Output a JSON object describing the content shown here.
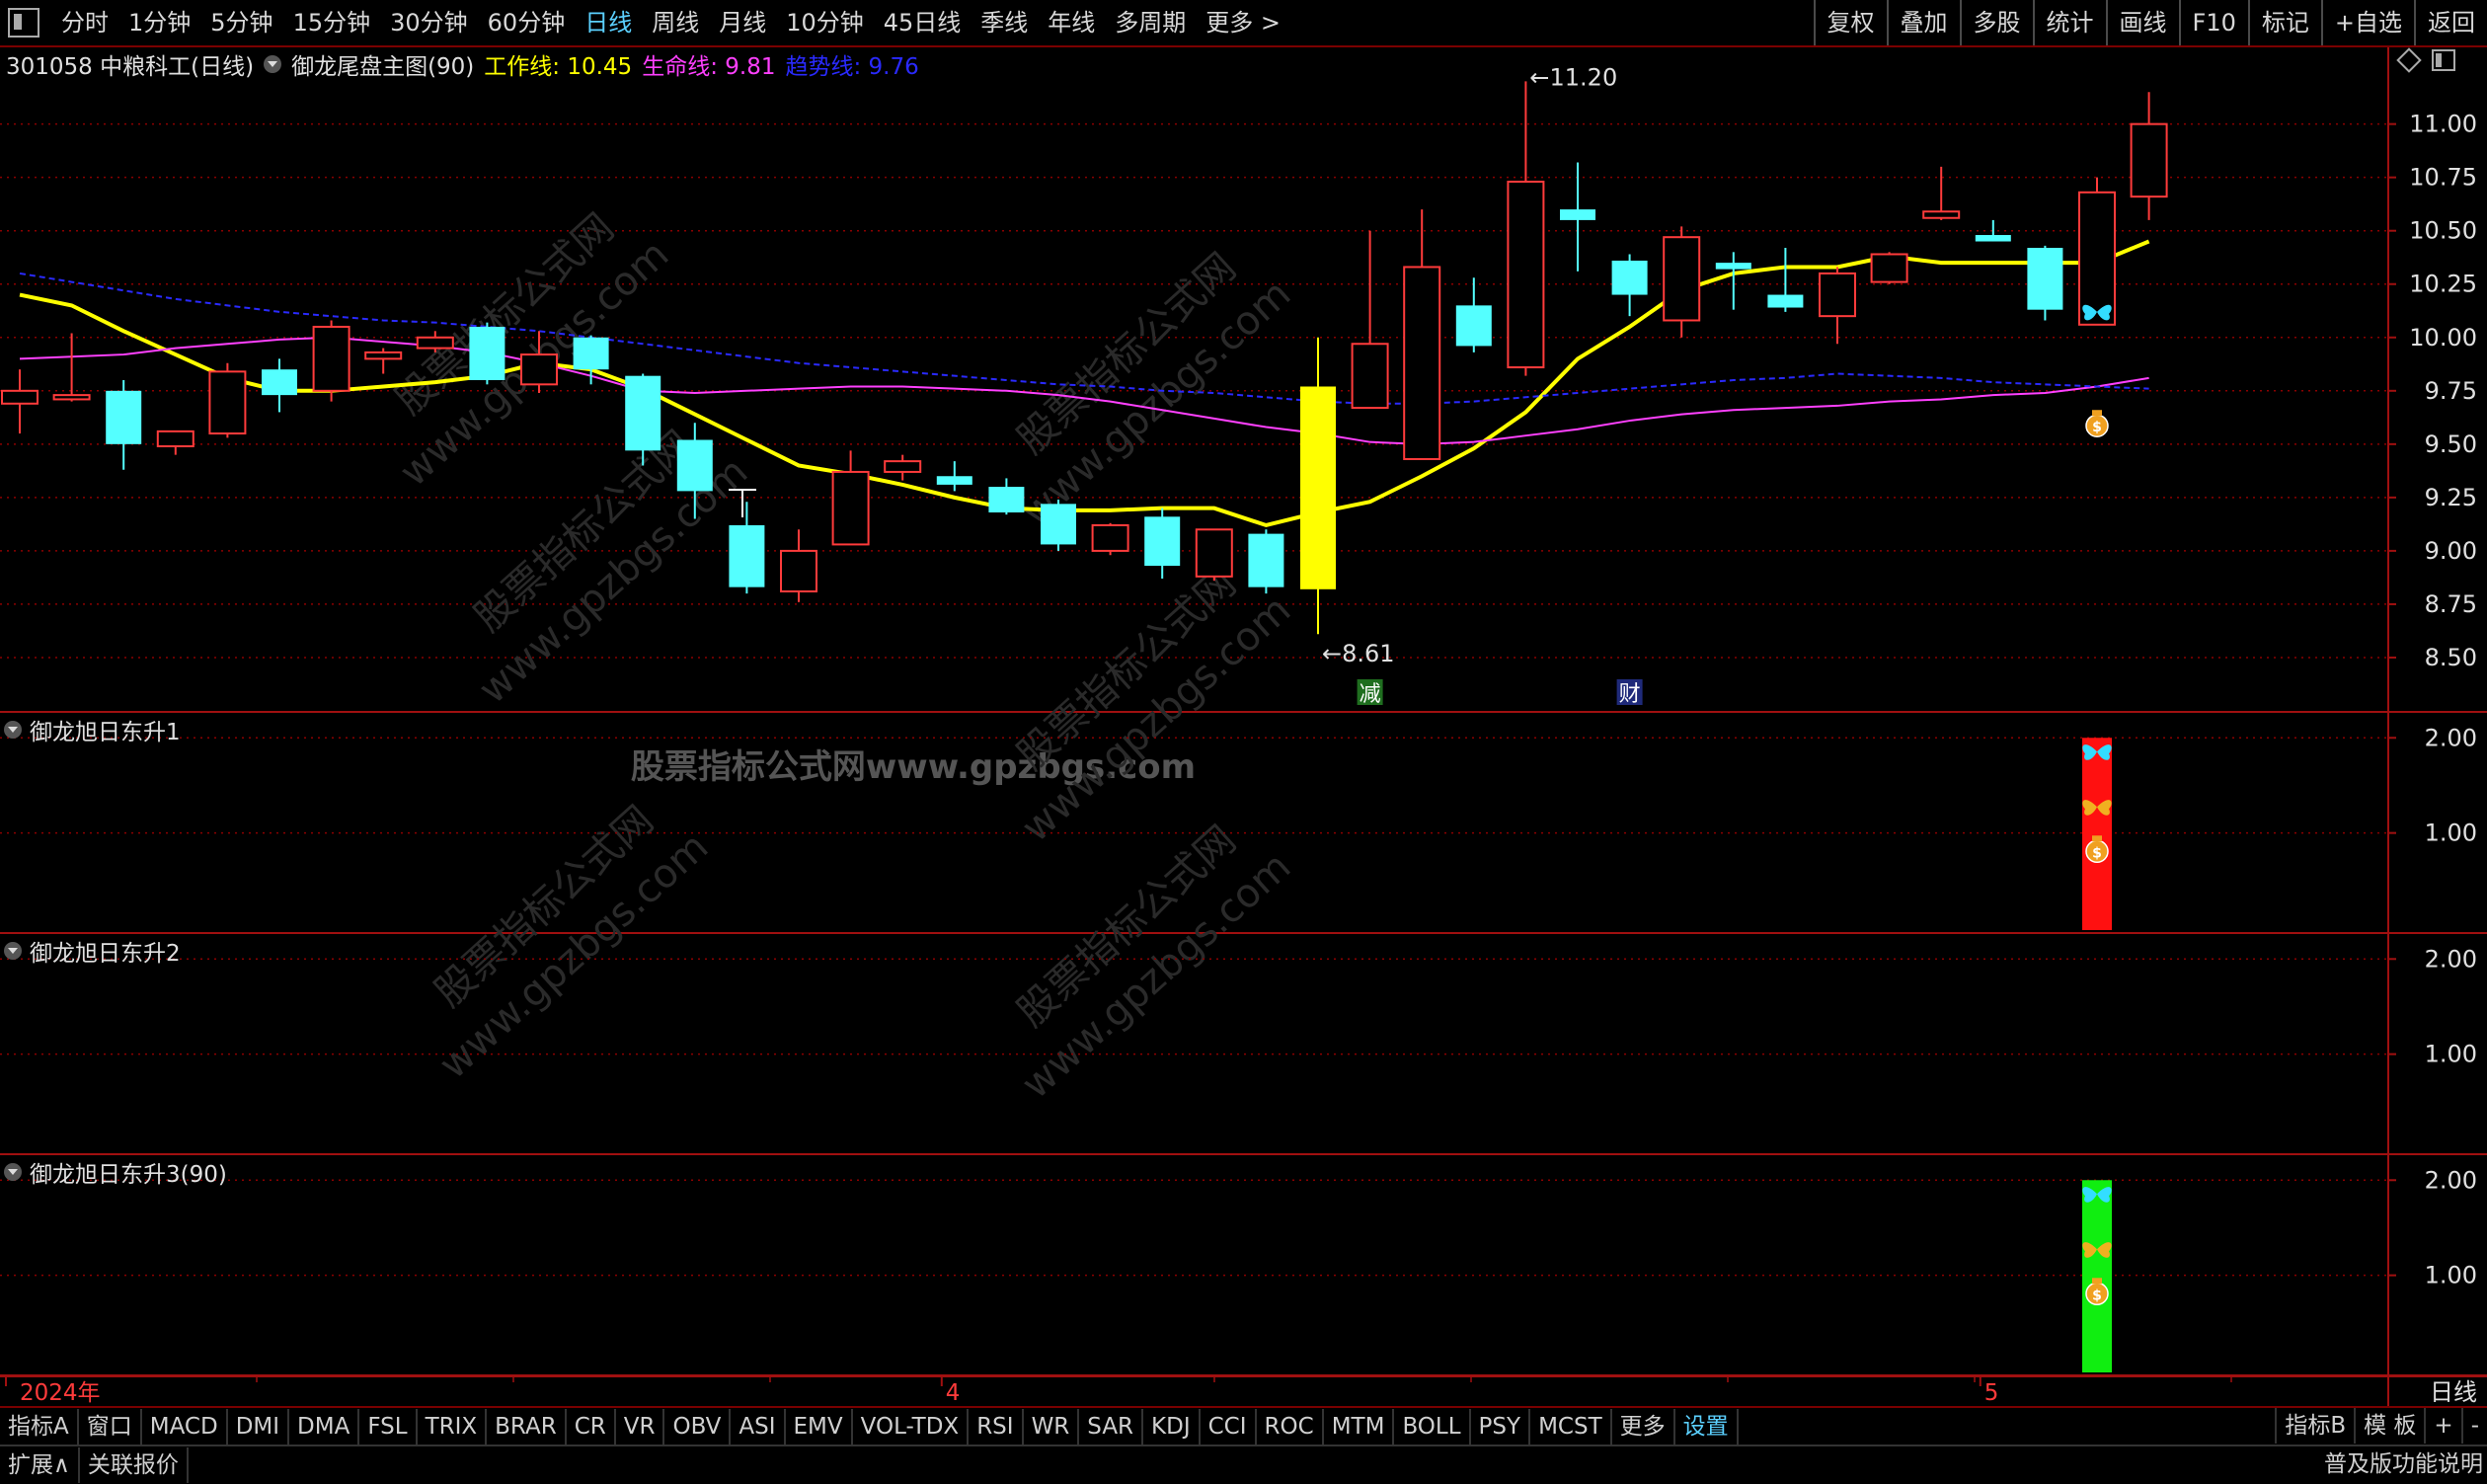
{
  "toolbar": {
    "periods": [
      "分时",
      "1分钟",
      "5分钟",
      "15分钟",
      "30分钟",
      "60分钟",
      "日线",
      "周线",
      "月线",
      "10分钟",
      "45日线",
      "季线",
      "年线",
      "多周期",
      "更多 >"
    ],
    "active_period": "日线",
    "right_buttons": [
      "复权",
      "叠加",
      "多股",
      "统计",
      "画线",
      "F10",
      "标记",
      "+自选",
      "返回"
    ]
  },
  "info": {
    "stock": "301058 中粮科工(日线)",
    "indicator": "御龙尾盘主图(90)",
    "work_line": "工作线: 10.45",
    "life_line": "生命线: 9.81",
    "trend_line": "趋势线: 9.76"
  },
  "panels": [
    {
      "title": "御龙旭日东升1"
    },
    {
      "title": "御龙旭日东升2"
    },
    {
      "title": "御龙旭日东升3(90)"
    }
  ],
  "watermark": "股票指标公式网www.gpzbgs.com",
  "watermark_diag": [
    "股票指标公式网",
    "www.gpzbgs.com"
  ],
  "chart_data": {
    "type": "candlestick",
    "title": "301058 中粮科工(日线)",
    "y_ticks": [
      11.0,
      10.75,
      10.5,
      10.25,
      10.0,
      9.75,
      9.5,
      9.25,
      9.0,
      8.75,
      8.5
    ],
    "ylim": [
      8.25,
      11.35
    ],
    "x_labels": [
      "2024年",
      "4",
      "5"
    ],
    "x_label_index": [
      0,
      18,
      38
    ],
    "period_label": "日线",
    "max_label": "11.20",
    "min_label": "8.61",
    "event_markers": [
      {
        "index": 26,
        "text": "减"
      },
      {
        "index": 31,
        "text": "财"
      }
    ],
    "candles": [
      {
        "o": 9.69,
        "h": 9.85,
        "l": 9.55,
        "c": 9.75
      },
      {
        "o": 9.71,
        "h": 10.02,
        "l": 9.7,
        "c": 9.73
      },
      {
        "o": 9.75,
        "h": 9.8,
        "l": 9.38,
        "c": 9.5
      },
      {
        "o": 9.49,
        "h": 9.56,
        "l": 9.45,
        "c": 9.56
      },
      {
        "o": 9.55,
        "h": 9.88,
        "l": 9.53,
        "c": 9.84
      },
      {
        "o": 9.85,
        "h": 9.9,
        "l": 9.65,
        "c": 9.73
      },
      {
        "o": 9.75,
        "h": 10.08,
        "l": 9.7,
        "c": 10.05
      },
      {
        "o": 9.9,
        "h": 9.95,
        "l": 9.83,
        "c": 9.93
      },
      {
        "o": 9.95,
        "h": 10.03,
        "l": 9.93,
        "c": 10.0
      },
      {
        "o": 10.05,
        "h": 10.07,
        "l": 9.78,
        "c": 9.8
      },
      {
        "o": 9.78,
        "h": 10.03,
        "l": 9.74,
        "c": 9.92
      },
      {
        "o": 10.0,
        "h": 10.01,
        "l": 9.78,
        "c": 9.85
      },
      {
        "o": 9.82,
        "h": 9.83,
        "l": 9.4,
        "c": 9.47
      },
      {
        "o": 9.52,
        "h": 9.6,
        "l": 9.15,
        "c": 9.28
      },
      {
        "o": 9.12,
        "h": 9.23,
        "l": 8.8,
        "c": 8.83
      },
      {
        "o": 8.81,
        "h": 9.1,
        "l": 8.76,
        "c": 9.0
      },
      {
        "o": 9.03,
        "h": 9.47,
        "l": 9.03,
        "c": 9.37
      },
      {
        "o": 9.37,
        "h": 9.45,
        "l": 9.33,
        "c": 9.42
      },
      {
        "o": 9.35,
        "h": 9.42,
        "l": 9.28,
        "c": 9.31
      },
      {
        "o": 9.3,
        "h": 9.34,
        "l": 9.17,
        "c": 9.18
      },
      {
        "o": 9.22,
        "h": 9.24,
        "l": 9.0,
        "c": 9.03
      },
      {
        "o": 9.0,
        "h": 9.13,
        "l": 8.98,
        "c": 9.12
      },
      {
        "o": 9.16,
        "h": 9.2,
        "l": 8.87,
        "c": 8.93
      },
      {
        "o": 8.88,
        "h": 9.1,
        "l": 8.86,
        "c": 9.1
      },
      {
        "o": 9.08,
        "h": 9.1,
        "l": 8.8,
        "c": 8.83
      },
      {
        "o": 8.82,
        "h": 10.0,
        "l": 8.61,
        "c": 9.77
      },
      {
        "o": 9.67,
        "h": 10.5,
        "l": 9.67,
        "c": 9.97
      },
      {
        "o": 9.43,
        "h": 10.6,
        "l": 9.43,
        "c": 10.33
      },
      {
        "o": 10.15,
        "h": 10.28,
        "l": 9.93,
        "c": 9.96
      },
      {
        "o": 9.86,
        "h": 11.2,
        "l": 9.82,
        "c": 10.73
      },
      {
        "o": 10.6,
        "h": 10.82,
        "l": 10.31,
        "c": 10.55
      },
      {
        "o": 10.36,
        "h": 10.39,
        "l": 10.1,
        "c": 10.2
      },
      {
        "o": 10.08,
        "h": 10.52,
        "l": 10.0,
        "c": 10.47
      },
      {
        "o": 10.35,
        "h": 10.4,
        "l": 10.13,
        "c": 10.32
      },
      {
        "o": 10.2,
        "h": 10.42,
        "l": 10.12,
        "c": 10.14
      },
      {
        "o": 10.1,
        "h": 10.33,
        "l": 9.97,
        "c": 10.3
      },
      {
        "o": 10.26,
        "h": 10.4,
        "l": 10.25,
        "c": 10.39
      },
      {
        "o": 10.56,
        "h": 10.8,
        "l": 10.55,
        "c": 10.59
      },
      {
        "o": 10.48,
        "h": 10.55,
        "l": 10.45,
        "c": 10.45
      },
      {
        "o": 10.42,
        "h": 10.43,
        "l": 10.08,
        "c": 10.13
      },
      {
        "o": 10.06,
        "h": 10.75,
        "l": 10.06,
        "c": 10.68
      },
      {
        "o": 10.66,
        "h": 11.15,
        "l": 10.55,
        "c": 11.0
      }
    ],
    "series": [
      {
        "name": "工作线",
        "color": "#ffff00",
        "values": [
          10.2,
          10.15,
          10.03,
          9.92,
          9.81,
          9.75,
          9.75,
          9.77,
          9.79,
          9.82,
          9.88,
          9.85,
          9.76,
          9.64,
          9.52,
          9.4,
          9.36,
          9.31,
          9.25,
          9.2,
          9.19,
          9.19,
          9.2,
          9.2,
          9.12,
          9.18,
          9.23,
          9.35,
          9.48,
          9.65,
          9.9,
          10.05,
          10.22,
          10.3,
          10.33,
          10.33,
          10.38,
          10.35,
          10.35,
          10.35,
          10.35,
          10.45
        ]
      },
      {
        "name": "生命线",
        "color": "#ff40ff",
        "values": [
          9.9,
          9.91,
          9.92,
          9.95,
          9.97,
          9.99,
          10.0,
          9.98,
          9.96,
          9.93,
          9.88,
          9.82,
          9.75,
          9.74,
          9.75,
          9.76,
          9.77,
          9.77,
          9.76,
          9.75,
          9.73,
          9.7,
          9.66,
          9.62,
          9.58,
          9.55,
          9.51,
          9.5,
          9.51,
          9.54,
          9.57,
          9.61,
          9.64,
          9.66,
          9.67,
          9.68,
          9.7,
          9.71,
          9.73,
          9.74,
          9.77,
          9.81
        ]
      },
      {
        "name": "趋势线",
        "color": "#2a2aff",
        "dashed": true,
        "values": [
          10.3,
          10.26,
          10.22,
          10.18,
          10.15,
          10.12,
          10.1,
          10.08,
          10.07,
          10.05,
          10.03,
          10.0,
          9.97,
          9.94,
          9.91,
          9.88,
          9.86,
          9.84,
          9.82,
          9.8,
          9.78,
          9.77,
          9.75,
          9.74,
          9.72,
          9.7,
          9.69,
          9.69,
          9.7,
          9.72,
          9.74,
          9.76,
          9.78,
          9.8,
          9.81,
          9.83,
          9.82,
          9.81,
          9.79,
          9.78,
          9.77,
          9.76
        ]
      }
    ],
    "signal_markers": [
      {
        "index": 40,
        "type": "butterfly",
        "color": "#33ddff",
        "value": 10.12
      },
      {
        "index": 40,
        "type": "money-bag",
        "value": 9.6
      }
    ],
    "sub_panels": [
      {
        "y_ticks": [
          2.0,
          1.0
        ],
        "ylim": [
          0,
          2.2
        ],
        "bars": [
          {
            "index": 40,
            "value": 2.0,
            "color": "#ff1010"
          }
        ],
        "icons": [
          "butterfly-cyan",
          "butterfly-gold",
          "money-bag"
        ]
      },
      {
        "y_ticks": [
          2.0,
          1.0
        ],
        "ylim": [
          0,
          2.2
        ],
        "bars": []
      },
      {
        "y_ticks": [
          2.0,
          1.0
        ],
        "ylim": [
          0,
          2.2
        ],
        "bars": [
          {
            "index": 40,
            "value": 2.0,
            "color": "#10ee10"
          }
        ],
        "icons": [
          "butterfly-cyan",
          "butterfly-gold",
          "money-bag"
        ]
      }
    ],
    "colors": {
      "up": "#ff3b3b",
      "down": "#54ffff",
      "grid": "#8b0000",
      "axis": "#a01010"
    }
  },
  "bottom_tabs": [
    "指标A",
    "窗口",
    "MACD",
    "DMI",
    "DMA",
    "FSL",
    "TRIX",
    "BRAR",
    "CR",
    "VR",
    "OBV",
    "ASI",
    "EMV",
    "VOL-TDX",
    "RSI",
    "WR",
    "SAR",
    "KDJ",
    "CCI",
    "ROC",
    "MTM",
    "BOLL",
    "PSY",
    "MCST",
    "更多",
    "设置"
  ],
  "bottom_active": "设置",
  "bottom_right": [
    "指标B",
    "模 板",
    "+",
    "-"
  ],
  "footer": {
    "expand": "扩展∧",
    "linked": "关联报价",
    "version": "普及版功能说明"
  }
}
